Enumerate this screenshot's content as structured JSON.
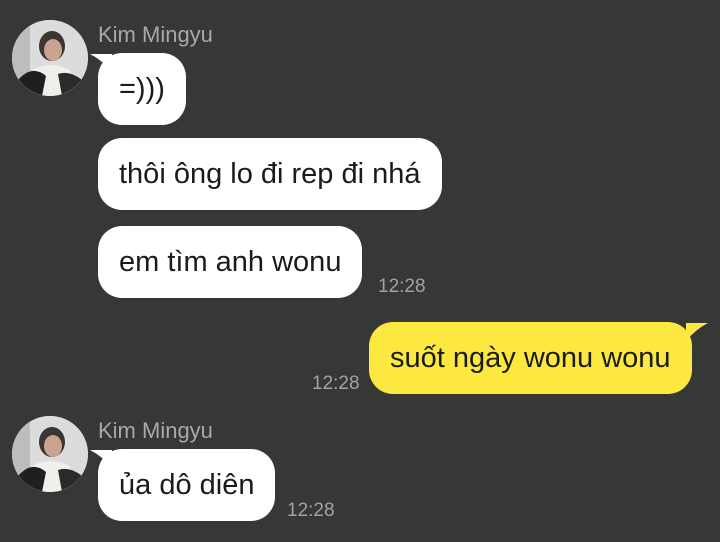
{
  "messages": [
    {
      "sender": "Kim Mingyu",
      "text": "=)))",
      "direction": "in"
    },
    {
      "text": "thôi ông lo đi rep đi nhá",
      "direction": "in"
    },
    {
      "text": "em tìm anh wonu",
      "direction": "in",
      "time": "12:28"
    },
    {
      "text": "suốt ngày wonu wonu",
      "direction": "out",
      "time": "12:28"
    },
    {
      "sender": "Kim Mingyu",
      "text": "ủa dô diên",
      "direction": "in",
      "time": "12:28"
    }
  ],
  "colors": {
    "background": "#363835",
    "incoming_bubble": "#ffffff",
    "outgoing_bubble": "#fde83f",
    "sender_name": "#a8a8a8",
    "timestamp": "#a2a2a2"
  },
  "icons": {
    "avatar": "profile-photo-avatar"
  }
}
